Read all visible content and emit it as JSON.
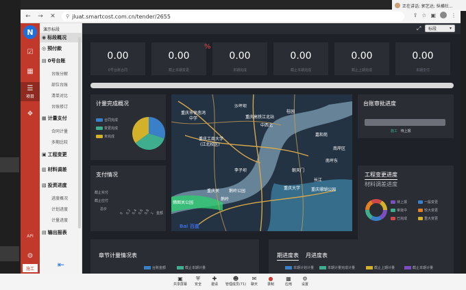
{
  "share_notice": {
    "text": "正在讲话: 郭艺达; 纵横社..."
  },
  "browser": {
    "url": "jluat.smartcost.com.cn/tender/2655",
    "back_icon": "arrow-left-icon",
    "forward_icon": "arrow-right-icon",
    "close_icon": "close-icon"
  },
  "rail": {
    "logo_letter": "N",
    "items": [
      {
        "icon": "checkbox-icon",
        "label": ""
      },
      {
        "icon": "grid-icon",
        "label": ""
      },
      {
        "icon": "list-icon",
        "label": "项目"
      },
      {
        "icon": "cubes-icon",
        "label": ""
      }
    ],
    "api": "API",
    "settings_icon": "gear-icon",
    "shigong": "施工"
  },
  "menu": {
    "project": "演示标段",
    "items": [
      {
        "label": "标段概况",
        "icon": "dashboard-icon"
      },
      {
        "label": "预付款",
        "icon": "eye-icon"
      },
      {
        "label": "0号台账",
        "icon": "ledger-icon"
      },
      {
        "label": "台账分解",
        "sub": true
      },
      {
        "label": "部位台账",
        "sub": true
      },
      {
        "label": "清单对比",
        "sub": true
      },
      {
        "label": "台账修订",
        "sub": true
      },
      {
        "label": "计量支付",
        "icon": "calc-icon"
      },
      {
        "label": "合同计量",
        "sub": true
      },
      {
        "label": "多期比较",
        "sub": true
      },
      {
        "label": "工程变更",
        "icon": "change-icon"
      },
      {
        "label": "材料调差",
        "icon": "chart-icon"
      },
      {
        "label": "投资进度",
        "icon": "progress-icon"
      },
      {
        "label": "进度概况",
        "sub": true
      },
      {
        "label": "计划进度",
        "sub": true
      },
      {
        "label": "计量进度",
        "sub": true
      },
      {
        "label": "输出报表",
        "icon": "report-icon"
      }
    ]
  },
  "topbar": {
    "select": "标段"
  },
  "kpis": [
    {
      "value": "0.00",
      "label": "0号台账合同"
    },
    {
      "value": "0.00",
      "label": "截止本期变更"
    },
    {
      "value": "0.00",
      "label": "本期完成"
    },
    {
      "value": "0.00",
      "label": "截止本期完成"
    },
    {
      "value": "0.00",
      "label": "截止上期完成"
    },
    {
      "value": "0.00",
      "label": "本期支付"
    }
  ],
  "progress_pct": 100,
  "measure_overview": {
    "title": "计量完成概况",
    "legend": [
      "合同完成",
      "变更完成",
      "未完成"
    ],
    "colors": [
      "#3a80c9",
      "#3fae8e",
      "#d4b12a"
    ],
    "values": [
      30,
      35,
      35
    ]
  },
  "payment": {
    "title": "支付情况",
    "rows": [
      "截止实付",
      "截止应付",
      "总价"
    ],
    "ticks": [
      "0",
      "0.2",
      "0.4",
      "0.6",
      "0.8",
      "1"
    ],
    "unit": "金额"
  },
  "map": {
    "labels": [
      "重庆市徐悲鸿",
      "中学",
      "重庆工商大学",
      "(江北校区)",
      "沙坪坝",
      "重庆高铁江北站",
      "中西北",
      "桂园",
      "嘉和苑",
      "南坪东",
      "鹅岭公园",
      "重庆关",
      "朝天门",
      "长江",
      "鹅岭",
      "重庆大学",
      "重庆珊瑚公园",
      "南岸区",
      "李子坝",
      "佛图关公园"
    ],
    "baidu": "Bai 百度"
  },
  "audit": {
    "title": "台账审批进度",
    "step": "施工",
    "status": "待上报"
  },
  "change_progress": {
    "tab1": "工程变更进度",
    "tab2": "材料调差进度",
    "legend": [
      {
        "label": "待上报",
        "color": "#7b4fc1"
      },
      {
        "label": "一般变更",
        "color": "#3a80c9"
      },
      {
        "label": "审批中",
        "color": "#3fae8e"
      },
      {
        "label": "较大变更",
        "color": "#e67e22"
      },
      {
        "label": "已完成",
        "color": "#d04848"
      },
      {
        "label": "重大变更",
        "color": "#d4b12a"
      }
    ]
  },
  "chapter": {
    "title": "章节计量情况表",
    "legend": [
      {
        "label": "台账金额",
        "color": "#3a80c9"
      },
      {
        "label": "截止本期计量",
        "color": "#3fae8e"
      }
    ]
  },
  "schedule": {
    "tabs": [
      "期进度表",
      "月进度表"
    ],
    "legend": [
      {
        "label": "本期计划计量",
        "color": "#3a80c9"
      },
      {
        "label": "本期计量完成计量",
        "color": "#3fae8e"
      },
      {
        "label": "截止上期计量",
        "color": "#d4b12a"
      },
      {
        "label": "截止本期计量",
        "color": "#7b4fc1"
      }
    ]
  },
  "taskbar": [
    {
      "icon": "screen-share-icon",
      "label": "共享屏幕"
    },
    {
      "icon": "shield-icon",
      "label": "安全"
    },
    {
      "icon": "invite-icon",
      "label": "邀请"
    },
    {
      "icon": "members-icon",
      "label": "管理成员(71)"
    },
    {
      "icon": "chat-icon",
      "label": "聊天"
    },
    {
      "icon": "record-icon",
      "label": "录制"
    },
    {
      "icon": "apps-icon",
      "label": "应用"
    },
    {
      "icon": "gear-icon",
      "label": "设置"
    }
  ]
}
